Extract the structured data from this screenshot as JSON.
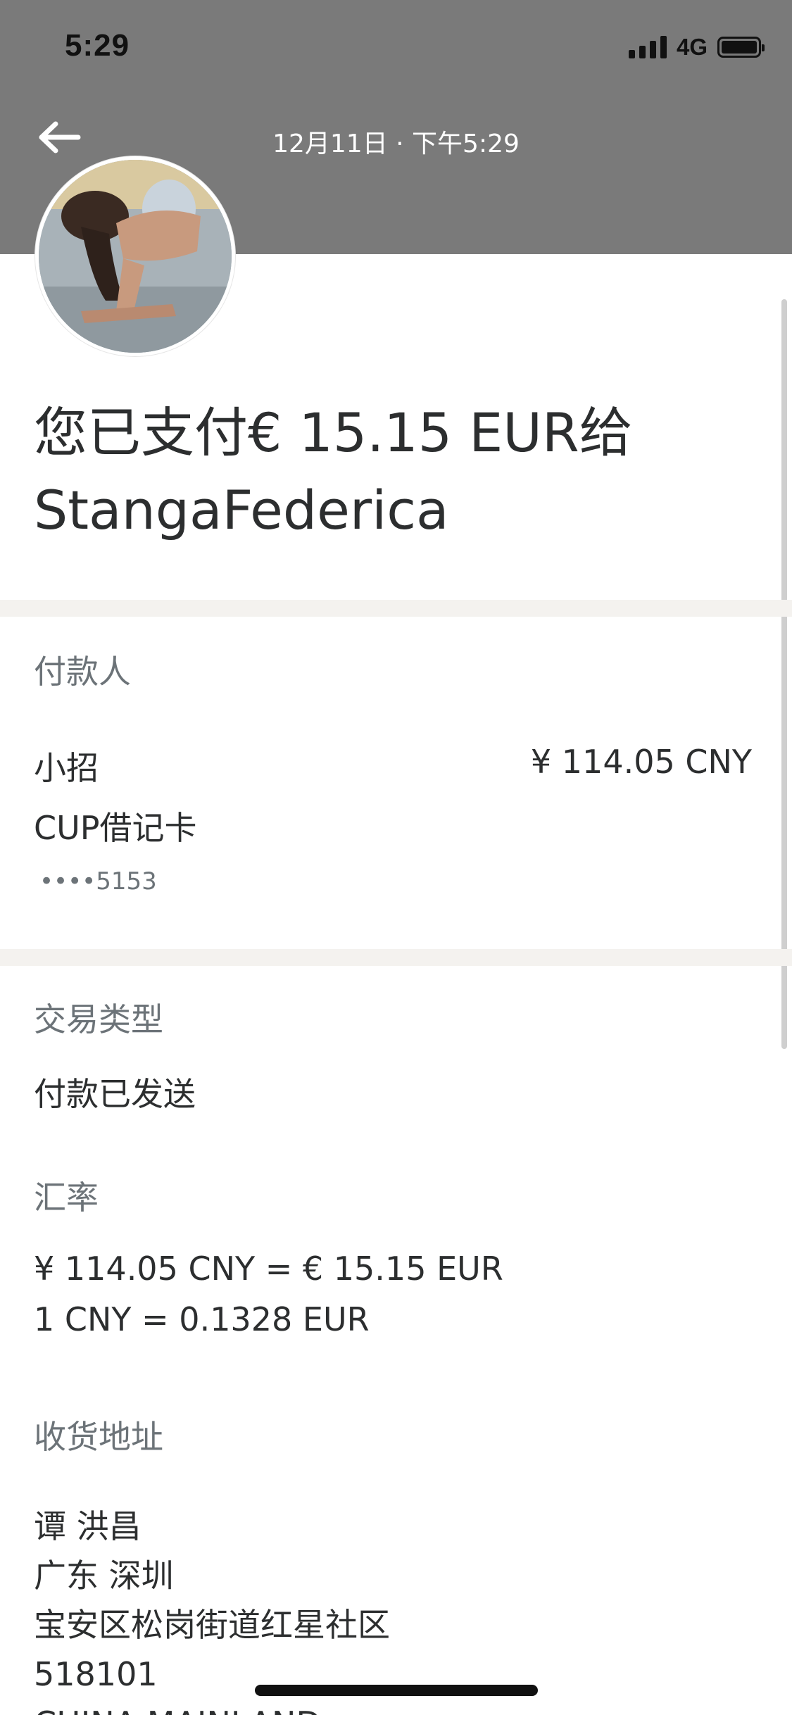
{
  "status_bar": {
    "time": "5:29",
    "network": "4G"
  },
  "header": {
    "title": "12月11日 · 下午5:29",
    "back_icon": "arrow-left-icon"
  },
  "summary": {
    "line1": "您已支付€ 15.15 EUR给",
    "line2": "StangaFederica"
  },
  "payer": {
    "label": "付款人",
    "name": "小招",
    "amount": "¥ 114.05 CNY",
    "card_type": "CUP借记卡",
    "card_number": "••••5153"
  },
  "transaction": {
    "type_label": "交易类型",
    "type_value": "付款已发送",
    "rate_label": "汇率",
    "rate_line1": "¥ 114.05 CNY = € 15.15 EUR",
    "rate_line2": "1 CNY = 0.1328 EUR"
  },
  "shipping": {
    "label": "收货地址",
    "name": "谭 洪昌",
    "province_city": "广东 深圳",
    "street": "宝安区松岗街道红星社区",
    "postcode": "518101",
    "country": "CHINA MAINLAND"
  },
  "colors": {
    "header_bg": "#7a7a7a",
    "divider": "#f4f2ef",
    "label_text": "#6c7378",
    "body_text": "#2c2e2f"
  }
}
